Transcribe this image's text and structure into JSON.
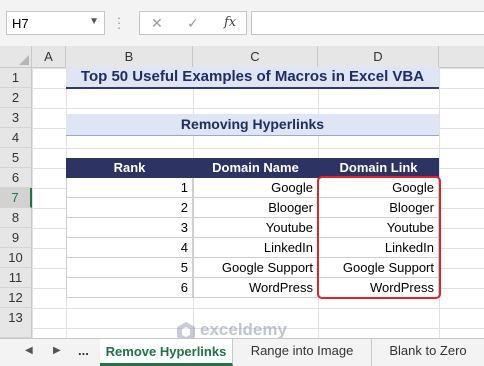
{
  "formula_bar": {
    "name_box": "H7",
    "cancel_icon": "✕",
    "enter_icon": "✓",
    "fx_label": "fx",
    "formula": ""
  },
  "columns": [
    "A",
    "B",
    "C",
    "D"
  ],
  "rows": [
    "1",
    "2",
    "3",
    "4",
    "5",
    "6",
    "7",
    "8",
    "9",
    "10",
    "11",
    "12",
    "13"
  ],
  "sheet": {
    "title": "Top 50 Useful Examples of Macros in Excel VBA",
    "subtitle": "Removing Hyperlinks",
    "headers": [
      "Rank",
      "Domain Name",
      "Domain Link"
    ],
    "table": [
      {
        "rank": "1",
        "name": "Google",
        "link": "Google"
      },
      {
        "rank": "2",
        "name": "Blooger",
        "link": "Blooger"
      },
      {
        "rank": "3",
        "name": "Youtube",
        "link": "Youtube"
      },
      {
        "rank": "4",
        "name": "LinkedIn",
        "link": "LinkedIn"
      },
      {
        "rank": "5",
        "name": "Google Support",
        "link": "Google Support"
      },
      {
        "rank": "6",
        "name": "WordPress",
        "link": "WordPress"
      }
    ]
  },
  "tabs": {
    "ellipsis": "...",
    "items": [
      "Remove Hyperlinks",
      "Range into Image",
      "Blank to Zero"
    ],
    "active": "Remove Hyperlinks"
  },
  "watermark": {
    "name": "exceldemy",
    "tagline": "EXCEL · DATA · BI"
  },
  "colors": {
    "header_fill": "#2d3464",
    "title_fill": "#dfe5f5",
    "highlight_border": "#e0242a",
    "excel_green": "#217346"
  }
}
